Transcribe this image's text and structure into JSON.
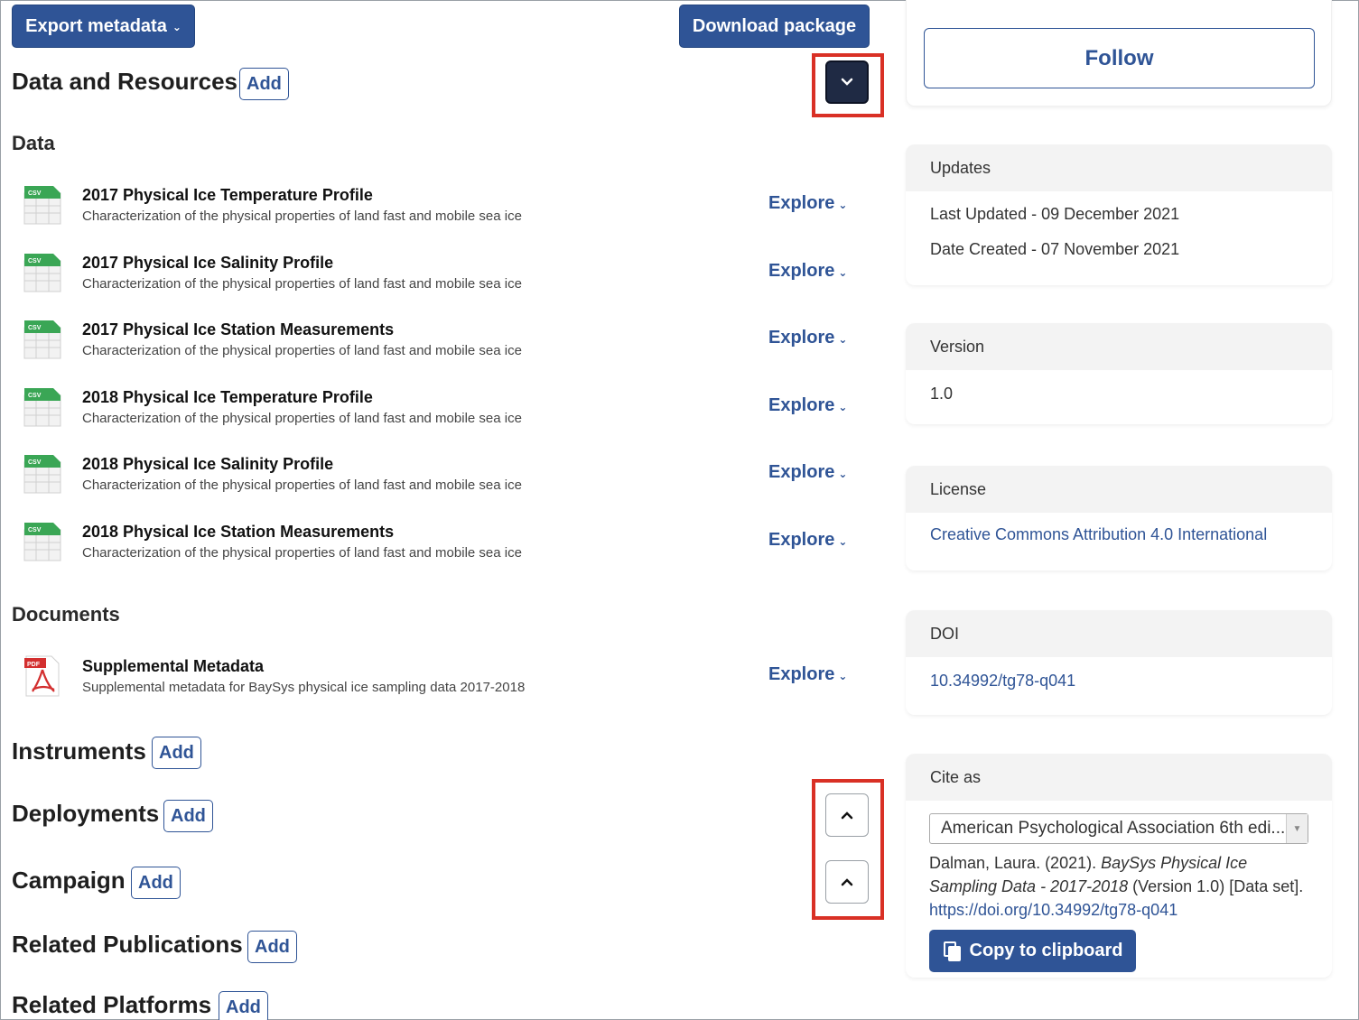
{
  "header": {
    "export_label": "Export metadata",
    "download_label": "Download package"
  },
  "data_resources": {
    "title": "Data and Resources",
    "add_label": "Add",
    "data_heading": "Data",
    "documents_heading": "Documents",
    "explore_label": "Explore",
    "data_items": [
      {
        "title": "2017 Physical Ice Temperature Profile",
        "desc": "Characterization of the physical properties of land fast and mobile sea ice",
        "format": "CSV"
      },
      {
        "title": "2017 Physical Ice Salinity Profile",
        "desc": "Characterization of the physical properties of land fast and mobile sea ice",
        "format": "CSV"
      },
      {
        "title": "2017 Physical Ice Station Measurements",
        "desc": "Characterization of the physical properties of land fast and mobile sea ice",
        "format": "CSV"
      },
      {
        "title": "2018 Physical Ice Temperature Profile",
        "desc": "Characterization of the physical properties of land fast and mobile sea ice",
        "format": "CSV"
      },
      {
        "title": "2018 Physical Ice Salinity Profile",
        "desc": "Characterization of the physical properties of land fast and mobile sea ice",
        "format": "CSV"
      },
      {
        "title": "2018 Physical Ice Station Measurements",
        "desc": "Characterization of the physical properties of land fast and mobile sea ice",
        "format": "CSV"
      }
    ],
    "document_items": [
      {
        "title": "Supplemental Metadata",
        "desc": "Supplemental metadata for BaySys physical ice sampling data 2017-2018",
        "format": "PDF"
      }
    ]
  },
  "sections": {
    "instruments": "Instruments",
    "deployments": "Deployments",
    "campaign": "Campaign",
    "related_publications": "Related Publications",
    "related_platforms": "Related Platforms",
    "add_label": "Add"
  },
  "sidebar": {
    "follow_label": "Follow",
    "updates": {
      "heading": "Updates",
      "last_updated": "Last Updated - 09 December 2021",
      "date_created": "Date Created - 07 November 2021"
    },
    "version": {
      "heading": "Version",
      "value": "1.0"
    },
    "license": {
      "heading": "License",
      "value": "Creative Commons Attribution 4.0 International"
    },
    "doi": {
      "heading": "DOI",
      "value": "10.34992/tg78-q041"
    },
    "cite": {
      "heading": "Cite as",
      "style_selected": "American Psychological Association 6th edi...",
      "citation_prefix": "Dalman, Laura. (2021). ",
      "citation_title": "BaySys Physical Ice Sampling Data - 2017-2018",
      "citation_suffix": " (Version 1.0) [Data set].",
      "citation_link": "https://doi.org/10.34992/tg78-q041",
      "copy_label": "Copy to clipboard"
    }
  },
  "colors": {
    "primary": "#2f5496",
    "dark_toggle": "#1f2a44",
    "highlight": "#d93025",
    "csv_green": "#3aa655",
    "pdf_red": "#d32f2f"
  }
}
